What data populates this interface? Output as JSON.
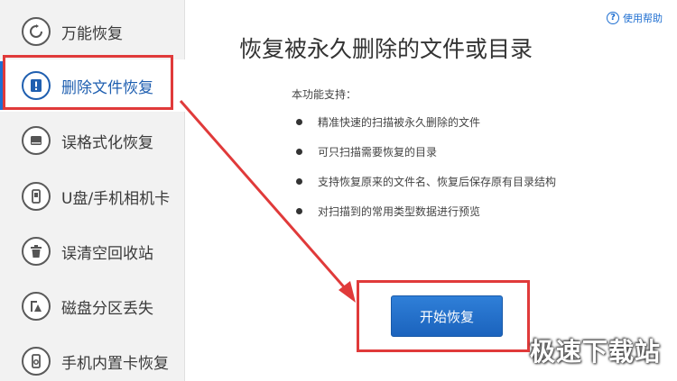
{
  "sidebar": {
    "items": [
      {
        "label": "万能恢复",
        "icon": "refresh-icon"
      },
      {
        "label": "删除文件恢复",
        "icon": "alert-file-icon"
      },
      {
        "label": "误格式化恢复",
        "icon": "disk-icon"
      },
      {
        "label": "U盘/手机相机卡",
        "icon": "usb-icon"
      },
      {
        "label": "误清空回收站",
        "icon": "trash-icon"
      },
      {
        "label": "磁盘分区丢失",
        "icon": "partition-icon"
      },
      {
        "label": "手机内置卡恢复",
        "icon": "phone-icon"
      }
    ],
    "active_index": 1
  },
  "main": {
    "help": "使用帮助",
    "title": "恢复被永久删除的文件或目录",
    "support_label": "本功能支持：",
    "features": [
      "精准快速的扫描被永久删除的文件",
      "可只扫描需要恢复的目录",
      "支持恢复原来的文件名、恢复后保存原有目录结构",
      "对扫描到的常用类型数据进行预览"
    ],
    "start_button": "开始恢复"
  },
  "watermark": "极速下载站",
  "colors": {
    "accent": "#1f6fd1",
    "highlight": "#e03a3a",
    "sidebar_bg": "#f2f2f2"
  }
}
